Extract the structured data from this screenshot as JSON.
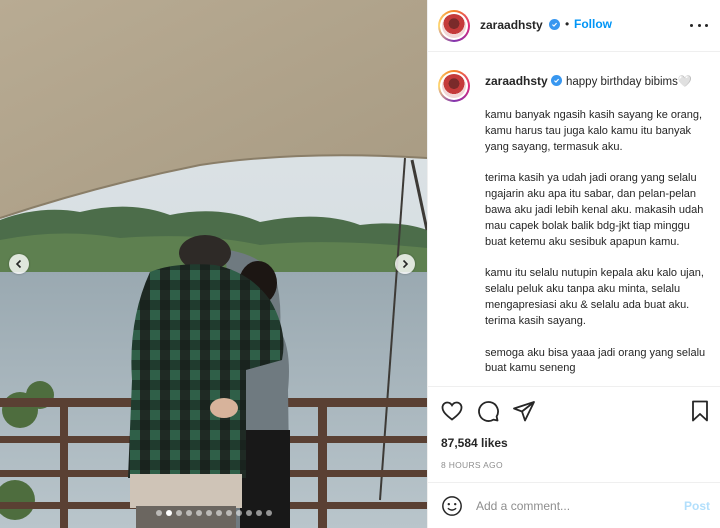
{
  "post": {
    "username": "zaraadhsty",
    "follow_label": "Follow",
    "separator": "•",
    "caption_first_line": "happy birthday bibims🤍",
    "caption_paragraphs": [
      "kamu banyak ngasih kasih sayang ke orang, kamu harus tau juga kalo kamu itu banyak yang sayang, termasuk aku.",
      "terima kasih ya udah jadi orang yang selalu ngajarin aku apa itu sabar, dan pelan-pelan bawa aku jadi lebih kenal aku. makasih udah mau capek bolak balik bdg-jkt tiap minggu buat ketemu aku sesibuk apapun kamu.",
      "kamu itu selalu nutupin kepala aku kalo ujan, selalu peluk aku tanpa aku minta, selalu mengapresiasi aku & selalu ada buat aku. terima kasih sayang.",
      "semoga aku bisa yaaa jadi orang yang selalu buat kamu seneng"
    ],
    "likes": "87,584 likes",
    "timestamp": "8 HOURS AGO"
  },
  "comment": {
    "placeholder": "Add a comment...",
    "post_label": "Post"
  },
  "carousel": {
    "total_slides": 12,
    "active_slide": 2
  },
  "colors": {
    "accent": "#0095f6",
    "post_disabled": "#b2dffc",
    "verified": "#3897f0"
  },
  "icons": [
    "more-icon",
    "heart-icon",
    "comment-icon",
    "share-icon",
    "bookmark-icon",
    "emoji-icon",
    "verified-icon",
    "chevron-left-icon",
    "chevron-right-icon"
  ]
}
